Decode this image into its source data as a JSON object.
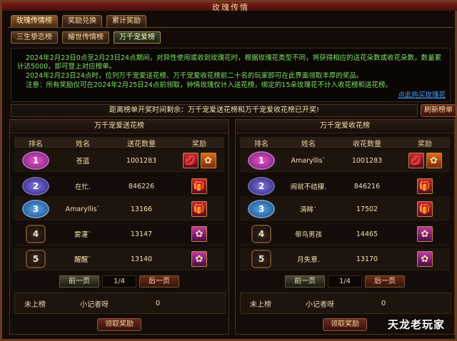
{
  "window": {
    "title": "玫瑰传情"
  },
  "tabs": [
    {
      "label": "玫瑰传情榜",
      "active": true
    },
    {
      "label": "奖励兑换",
      "active": false
    },
    {
      "label": "累计奖励",
      "active": false
    }
  ],
  "subtabs": [
    {
      "label": "三生挚恋榜",
      "active": false
    },
    {
      "label": "耀世传情榜",
      "active": false
    },
    {
      "label": "万千宠爱榜",
      "active": true
    }
  ],
  "description": {
    "line1": "2024年2月23日0点至2月23日24点期间，对异性使用或收到玫瑰花时，根据玫瑰花类型不同，将获得相应的送花朵数或收花朵数，数量累",
    "line2": "计达5000，即可登上对应榜单。",
    "line3": "2024年2月23日24点时，位列万千宠爱送花榜、万千宠爱收花榜前二十名的玩家即可在此界面领取丰厚的奖品。",
    "line4": "注意：所有奖励仅可在2024年2月25日24点前领取，钟情玫瑰仅计入送花榜，绑定的15朵玫瑰花不计入收花榜和送花榜。",
    "link": "点此购买玫瑰花"
  },
  "timer": {
    "text": "距离榜单开奖时间剩余：万千宠爱送花榜和万千宠爱收花榜已开奖!"
  },
  "refresh_label": "刷新榜单",
  "columns": {
    "rank": "排名",
    "name": "姓名",
    "reward": "奖励"
  },
  "send_board": {
    "title": "万千宠爱送花榜",
    "qty_col": "送花数量",
    "rows": [
      {
        "rank": "1",
        "name": "苍蓝",
        "qty": "1001283"
      },
      {
        "rank": "2",
        "name": "在忙.",
        "qty": "846226"
      },
      {
        "rank": "3",
        "name": "Amaryllis`",
        "qty": "13166"
      },
      {
        "rank": "4",
        "name": "雾灌`",
        "qty": "13147"
      },
      {
        "rank": "5",
        "name": "醒醒`",
        "qty": "13140"
      }
    ],
    "prev": "前一页",
    "page": "1/4",
    "next": "后一页",
    "mine": {
      "status": "未上榜",
      "name": "小记者呀",
      "qty": "0"
    },
    "claim": "领取奖励"
  },
  "receive_board": {
    "title": "万千宠爱收花榜",
    "qty_col": "收花数量",
    "rows": [
      {
        "rank": "1",
        "name": "Amaryllis`",
        "qty": "1001283"
      },
      {
        "rank": "2",
        "name": "闹就不结棲.",
        "qty": "846216"
      },
      {
        "rank": "3",
        "name": "清眸`",
        "qty": "17502"
      },
      {
        "rank": "4",
        "name": "带鸟男孩",
        "qty": "14465"
      },
      {
        "rank": "5",
        "name": "月失意.",
        "qty": "13170"
      }
    ],
    "prev": "前一页",
    "page": "1/4",
    "next": "后一页",
    "mine": {
      "status": "未上榜",
      "name": "小记者呀",
      "qty": "0"
    },
    "claim": "领取奖励"
  },
  "watermark": "天龙老玩家"
}
